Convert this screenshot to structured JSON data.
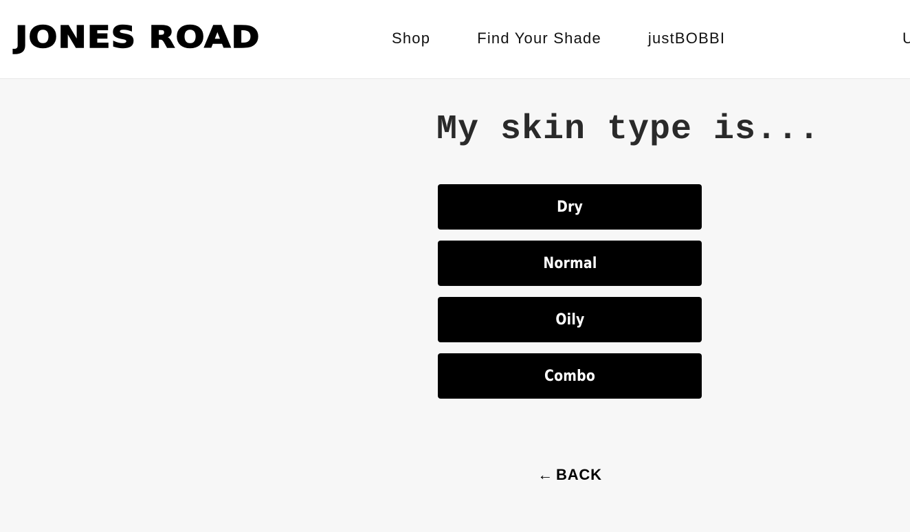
{
  "header": {
    "logo_text": "JONES ROAD",
    "nav": [
      {
        "label": "Shop"
      },
      {
        "label": "Find Your Shade"
      },
      {
        "label": "justBOBBI"
      }
    ],
    "edge_text": "U"
  },
  "quiz": {
    "question": "My skin type is...",
    "options": [
      {
        "label": "Dry"
      },
      {
        "label": "Normal"
      },
      {
        "label": "Oily"
      },
      {
        "label": "Combo"
      }
    ],
    "back_arrow": "←",
    "back_label": "BACK"
  },
  "colors": {
    "background": "#f7f7f7",
    "header_bg": "#ffffff",
    "button_bg": "#000000",
    "button_text": "#ffffff"
  }
}
